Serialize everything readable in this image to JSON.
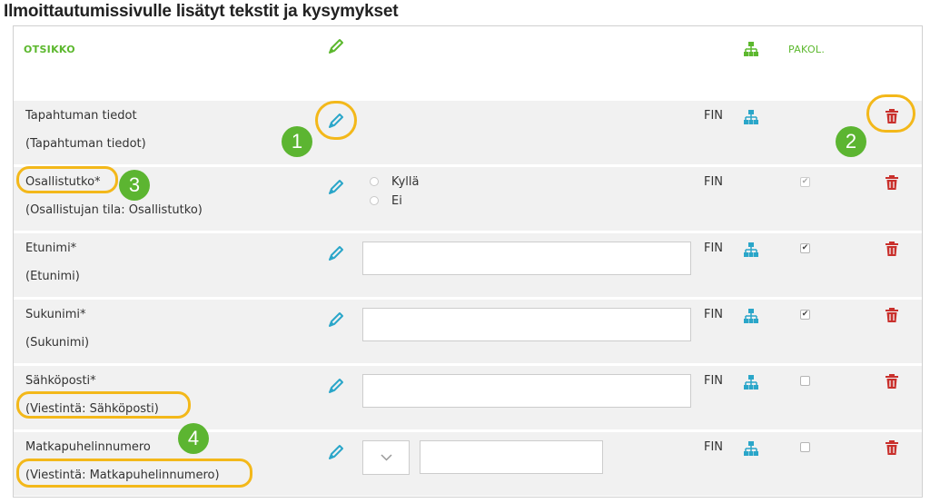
{
  "page_title": "Ilmoittautumissivulle lisätyt tekstit ja kysymykset",
  "header": {
    "col_title": "OTSIKKO",
    "col_required": "PAKOL."
  },
  "rows": [
    {
      "label": "Tapahtuman tiedot",
      "sublabel": "(Tapahtuman tiedot)",
      "language": "FIN"
    },
    {
      "label": "Osallistutko*",
      "sublabel": "(Osallistujan tila: Osallistutko)",
      "language": "FIN",
      "options": [
        "Kyllä",
        "Ei"
      ],
      "required": true
    },
    {
      "label": "Etunimi*",
      "sublabel": "(Etunimi)",
      "language": "FIN",
      "required": true
    },
    {
      "label": "Sukunimi*",
      "sublabel": "(Sukunimi)",
      "language": "FIN",
      "required": true
    },
    {
      "label": "Sähköposti*",
      "sublabel": "(Viestintä: Sähköposti)",
      "language": "FIN",
      "required": false
    },
    {
      "label": "Matkapuhelinnumero",
      "sublabel": "(Viestintä: Matkapuhelinnumero)",
      "language": "FIN",
      "required": false
    }
  ],
  "badges": [
    "1",
    "2",
    "3",
    "4"
  ],
  "colors": {
    "accent_green": "#5cb82e",
    "icon_blue": "#2aa6c9",
    "delete_red": "#c9302c",
    "highlight": "#f3b81a",
    "badge_green": "#5cb531"
  },
  "icons": {
    "edit": "pencil-icon",
    "hierarchy": "sitemap-icon",
    "delete": "trash-icon"
  }
}
